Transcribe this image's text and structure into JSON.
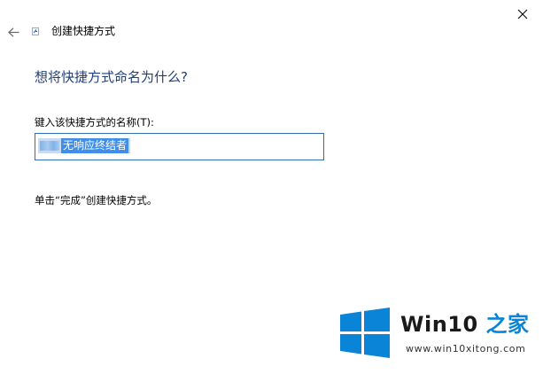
{
  "window": {
    "title": "创建快捷方式"
  },
  "main": {
    "heading": "想将快捷方式命名为什么?",
    "field_label": "键入该快捷方式的名称(T):",
    "name_value": "无响应终结者",
    "hint": "单击“完成”创建快捷方式。"
  },
  "watermark": {
    "brand_main": "Win10",
    "brand_accent": " 之家",
    "url": "www.win10xitong.com"
  },
  "colors": {
    "heading": "#1f3f7a",
    "input_border": "#2f6fb3",
    "selection": "#3f8ee8",
    "logo_blue": "#0a84d6"
  },
  "icons": {
    "close": "close-icon",
    "back": "back-arrow-icon",
    "app": "shortcut-icon",
    "logo": "windows-logo-icon"
  }
}
